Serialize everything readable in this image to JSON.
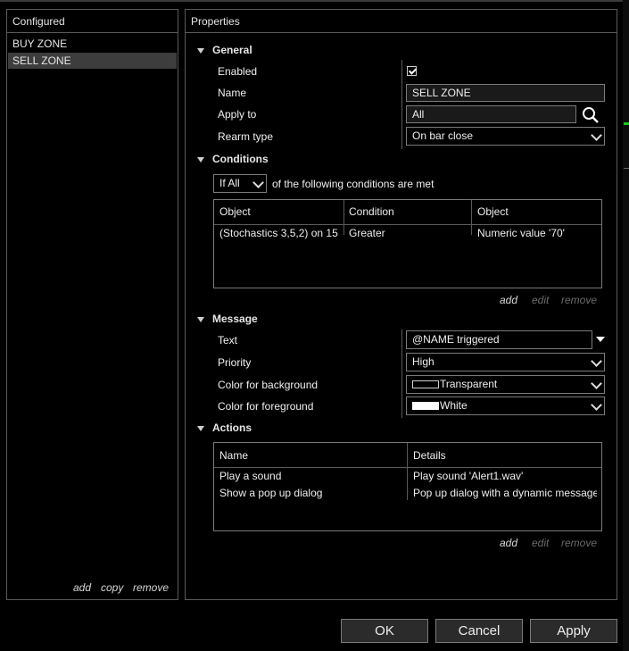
{
  "configured": {
    "title": "Configured",
    "items": [
      "BUY ZONE",
      "SELL ZONE"
    ],
    "actions": {
      "add": "add",
      "copy": "copy",
      "remove": "remove"
    }
  },
  "properties": {
    "title": "Properties",
    "general": {
      "heading": "General",
      "enabled_label": "Enabled",
      "enabled_checked": true,
      "name_label": "Name",
      "name_value": "SELL ZONE",
      "apply_label": "Apply to",
      "apply_value": "All",
      "rearm_label": "Rearm type",
      "rearm_value": "On bar close"
    },
    "conditions": {
      "heading": "Conditions",
      "mode": "If All",
      "mode_suffix": "of the following conditions are met",
      "columns": [
        "Object",
        "Condition",
        "Object"
      ],
      "rows": [
        [
          "(Stochastics 3,5,2) on 15",
          "Greater",
          "Numeric value '70'"
        ]
      ],
      "actions": {
        "add": "add",
        "edit": "edit",
        "remove": "remove"
      }
    },
    "message": {
      "heading": "Message",
      "text_label": "Text",
      "text_value": "@NAME triggered",
      "priority_label": "Priority",
      "priority_value": "High",
      "bg_label": "Color for background",
      "bg_value": "Transparent",
      "bg_color": "#000000",
      "fg_label": "Color for foreground",
      "fg_value": "White",
      "fg_color": "#ffffff"
    },
    "actions_section": {
      "heading": "Actions",
      "columns": [
        "Name",
        "Details"
      ],
      "rows": [
        [
          "Play a sound",
          "Play sound 'Alert1.wav'"
        ],
        [
          "Show a pop up dialog",
          "Pop up dialog with a dynamic message"
        ]
      ],
      "actions": {
        "add": "add",
        "edit": "edit",
        "remove": "remove"
      }
    }
  },
  "footer": {
    "ok": "OK",
    "cancel": "Cancel",
    "apply": "Apply"
  },
  "colors": {
    "background": "#000000",
    "border": "#5a5a5a",
    "selected": "#3d3d3d",
    "accent_edge": "#19c819"
  }
}
